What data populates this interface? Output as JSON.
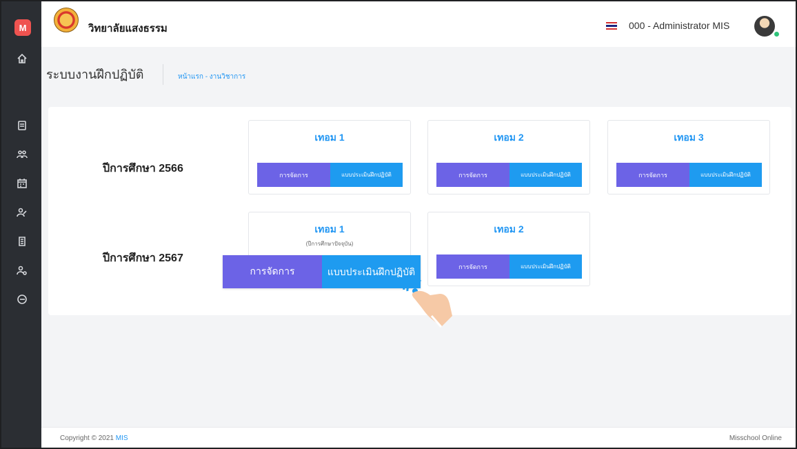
{
  "sidebar": {
    "logo_letter": "M",
    "items": [
      {
        "icon": "home-icon"
      },
      {
        "icon": "document-icon"
      },
      {
        "icon": "group-icon"
      },
      {
        "icon": "calendar-icon"
      },
      {
        "icon": "user-edit-icon"
      },
      {
        "icon": "notes-icon"
      },
      {
        "icon": "user-settings-icon"
      },
      {
        "icon": "logout-icon"
      }
    ]
  },
  "header": {
    "school_name": "วิทยาลัยแสงธรรม",
    "user": "000 - Administrator MIS"
  },
  "page": {
    "title": "ระบบงานฝึกปฏิบัติ",
    "breadcrumb": "หน้าแรก  - งานวิชาการ"
  },
  "years": [
    {
      "label": "ปีการศึกษา 2566",
      "terms": [
        {
          "title": "เทอม 1",
          "note": "",
          "manage": "การจัดการ",
          "eval": "แบบประเมินฝึกปฏิบัติ"
        },
        {
          "title": "เทอม 2",
          "note": "",
          "manage": "การจัดการ",
          "eval": "แบบประเมินฝึกปฏิบัติ"
        },
        {
          "title": "เทอม 3",
          "note": "",
          "manage": "การจัดการ",
          "eval": "แบบประเมินฝึกปฏิบัติ"
        }
      ]
    },
    {
      "label": "ปีการศึกษา 2567",
      "terms": [
        {
          "title": "เทอม 1",
          "note": "(ปีการศึกษาปัจจุบัน)",
          "manage": "การจัดการ",
          "eval": "แบบประเมินฝึกปฏิบัติ"
        },
        {
          "title": "เทอม 2",
          "note": "",
          "manage": "การจัดการ",
          "eval": "แบบประเมินฝึกปฏิบัติ"
        }
      ]
    }
  ],
  "footer": {
    "copyright": "Copyright © 2021 ",
    "copyright_link": "MIS",
    "brand": "Misschool Online"
  },
  "colors": {
    "manage_button": "#6c63e6",
    "eval_button": "#1e9bf0",
    "accent": "#2196f3",
    "sidebar": "#2b2e33"
  }
}
